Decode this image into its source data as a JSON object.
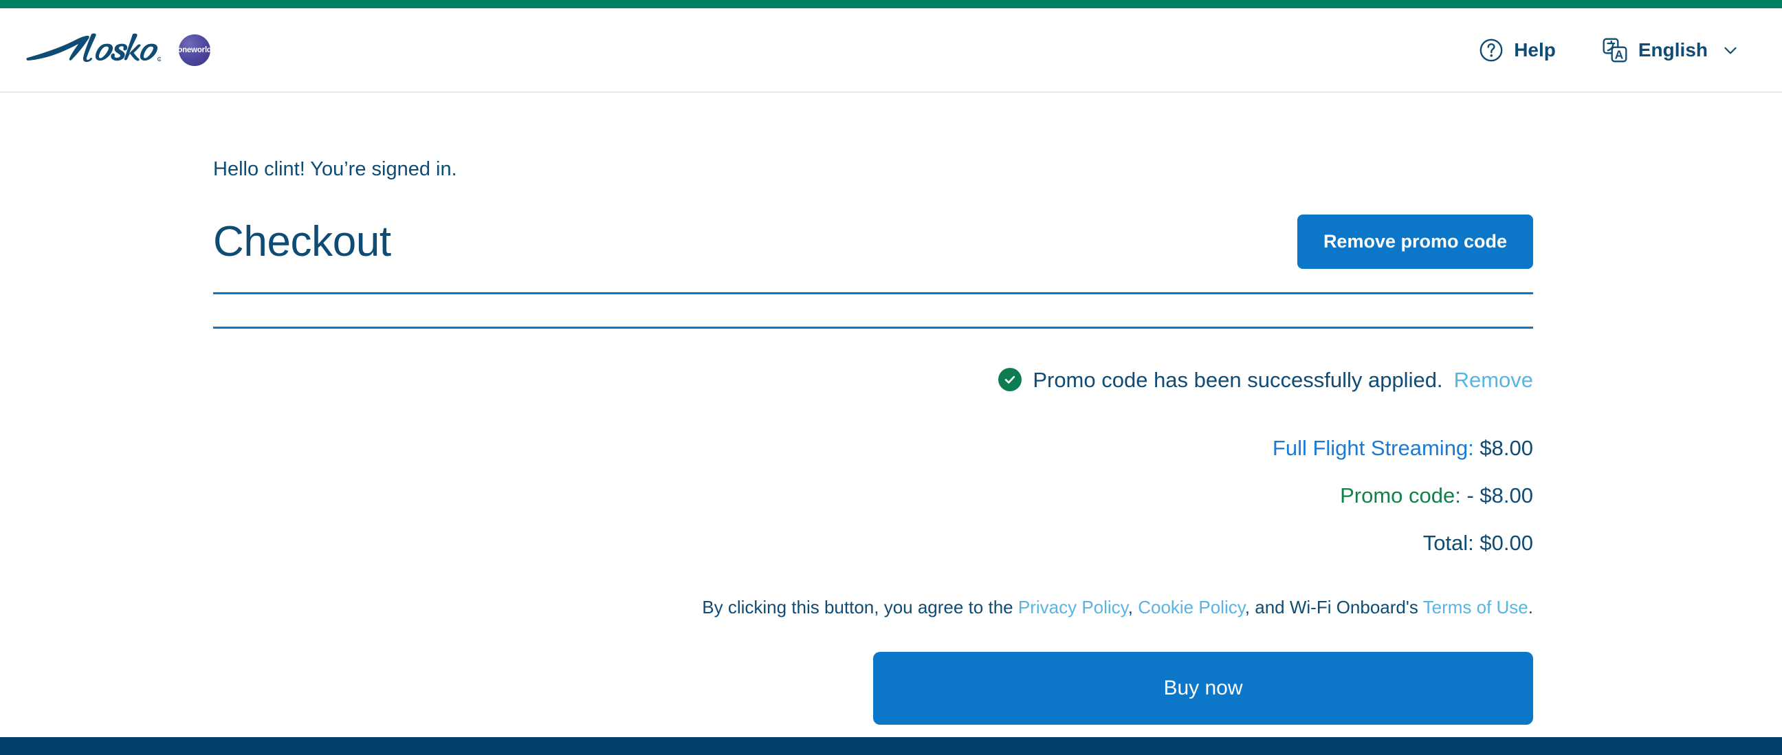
{
  "brand": {
    "airline_name": "Alaska",
    "alliance_badge": "oneworld",
    "logo_color": "#0e4b75",
    "alliance_color": "#4f4a9e"
  },
  "header": {
    "help_label": "Help",
    "help_icon": "question-circle-icon",
    "language_label": "English",
    "language_icon": "translate-icon",
    "chevron_icon": "chevron-down-icon",
    "accent_bar_color": "#007f63",
    "text_color": "#0e4b75"
  },
  "main": {
    "greeting": "Hello clint! You’re signed in.",
    "page_title": "Checkout",
    "remove_promo_button": "Remove promo code"
  },
  "summary": {
    "promo_status_icon": "check-circle-icon",
    "promo_status_text": "Promo code has been successfully applied.",
    "promo_remove_link": "Remove",
    "lines": [
      {
        "label": "Full Flight Streaming:",
        "value": "$8.00",
        "label_color": "#1a7ad4"
      },
      {
        "label": "Promo code:",
        "value": "- $8.00",
        "label_color": "#128048"
      },
      {
        "label": "Total:",
        "value": "$0.00",
        "label_color": "#0e4b75"
      }
    ]
  },
  "legal": {
    "prefix": "By clicking this button, you agree to the ",
    "privacy_policy": "Privacy Policy",
    "separator_1": ", ",
    "cookie_policy": "Cookie Policy",
    "separator_2": ", and Wi-Fi Onboard's ",
    "terms_of_use": "Terms of Use",
    "suffix": "."
  },
  "actions": {
    "buy_now": "Buy now",
    "primary_color": "#0c77c9"
  },
  "footer": {
    "bar_color": "#014069"
  }
}
